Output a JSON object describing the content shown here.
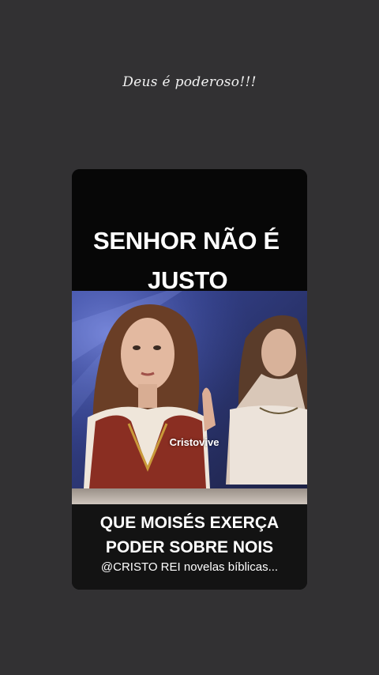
{
  "story": {
    "caption": "Deus é poderoso!!!",
    "background_color": "#323133"
  },
  "card": {
    "headline_line1": "SENHOR NÃO É",
    "headline_line2": "JUSTO",
    "watermark": "Cristovive",
    "bottom_line1": "QUE MOISÉS  EXERÇA",
    "bottom_line2": "PODER SOBRE NOIS",
    "attribution": "@CRISTO REI novelas bíblicas..."
  }
}
